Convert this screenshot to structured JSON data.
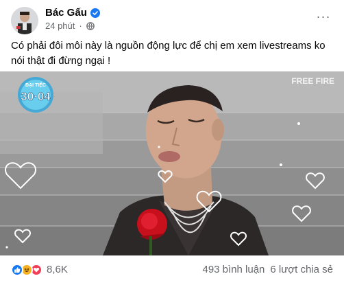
{
  "post": {
    "author": "Bác Gấu",
    "time": "24 phút",
    "separator": "·",
    "more_label": "···",
    "caption": "Có phải đôi môi này là nguồn động lực để chị em xem livestreams ko nói thật đi đừng ngại !"
  },
  "media": {
    "event_badge_top": "ĐẠI TIỆC",
    "event_badge_date": "30·04",
    "watermark": "FREE FIRE"
  },
  "footer": {
    "reaction_icons": [
      "like-icon",
      "haha-icon",
      "love-icon"
    ],
    "reaction_count": "8,6K",
    "comments": "493 bình luận",
    "shares": "6 lượt chia sẻ"
  },
  "colors": {
    "brand_blue": "#1877f2",
    "secondary_text": "#65676b",
    "haha_yellow": "#f7b125",
    "love_red": "#f33e58"
  }
}
